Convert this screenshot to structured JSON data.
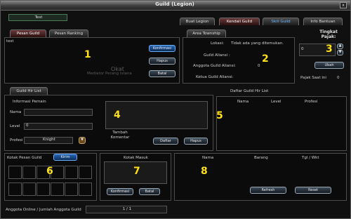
{
  "window": {
    "title": "Guild (Legion)",
    "close": "x"
  },
  "guild_name": "Test",
  "tabs": [
    {
      "label": "Buat Legion"
    },
    {
      "label": "Kendali Guild"
    },
    {
      "label": "Skill Guild"
    },
    {
      "label": "Info Bantuan"
    }
  ],
  "notice": {
    "tabs": [
      "Pesan Guild",
      "Pesan Ranking"
    ],
    "text": "test",
    "ghost_text": "Okat",
    "ghost_text2": "Mediator Perang Istana",
    "buttons": [
      "Konfirmasi",
      "Hapus",
      "Batal"
    ]
  },
  "township": {
    "tab": "Area Township",
    "rows": [
      {
        "label": "Lokasi:",
        "value": "Tidak ada yang ditemukan."
      },
      {
        "label": "Guild Aliansi :",
        "value": ""
      },
      {
        "label": "Anggota Guild Aliansi:",
        "value": "0"
      },
      {
        "label": "Ketua Guild Aliansi:",
        "value": ""
      }
    ]
  },
  "tax": {
    "title": "Tingkat Pajak:",
    "value": "0",
    "button": "Ubah",
    "current_label": "Pajak Saat ini",
    "current_value": "0"
  },
  "hirlist": {
    "tab": "Guild Hir List",
    "info_title": "Informasi Pemain",
    "fields": [
      {
        "label": "Nama",
        "value": ""
      },
      {
        "label": "Level",
        "value": "0"
      },
      {
        "label": "Profesi",
        "value": "Knight"
      }
    ],
    "comment_label": "Tambah Komentar",
    "buttons": [
      "Daftar",
      "Hapus"
    ]
  },
  "hirlist_table": {
    "title": "Daftar Guild Hir List",
    "columns": [
      "Nama",
      "Level",
      "Profesi"
    ]
  },
  "mailbox": {
    "title": "Kotak Pesan Guild",
    "button": "Kirim",
    "slots": 12
  },
  "inbox": {
    "title": "Kotak Masuk",
    "buttons": [
      "Konfirmasi",
      "Batal"
    ]
  },
  "messages": {
    "columns": [
      "Nama",
      "Barang",
      "Tgl / Wkt"
    ],
    "buttons": [
      "Refresh",
      "Reset"
    ]
  },
  "footer": {
    "label": "Anggota Online / Jumlah Anggota Guild",
    "value": "1 / 1"
  },
  "markers": [
    "1",
    "2",
    "3",
    "4",
    "5",
    "6",
    "7",
    "8"
  ],
  "colors": {
    "marker": "#ffe11a",
    "accent": "#66b9ff"
  }
}
